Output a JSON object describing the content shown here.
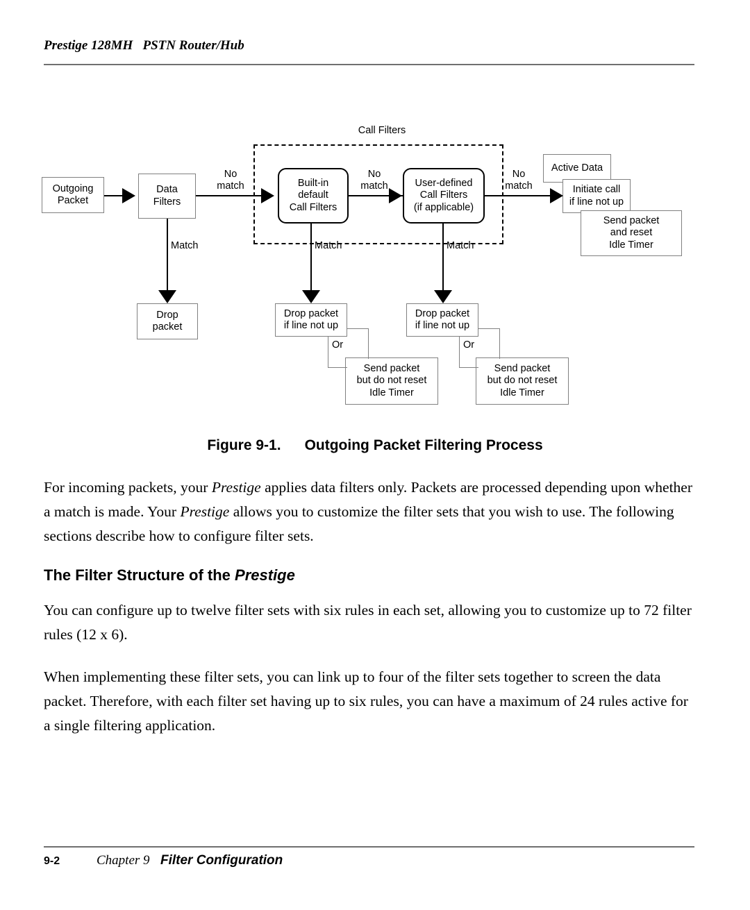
{
  "header": {
    "running_title": "Prestige 128MH   PSTN Router/Hub"
  },
  "figure": {
    "caption_number": "Figure 9-1.",
    "caption_title": "Outgoing Packet Filtering Process",
    "group_label": "Call Filters",
    "nodes": {
      "outgoing_packet": "Outgoing\nPacket",
      "data_filters": "Data\nFilters",
      "builtin_call_filters": "Built-in\ndefault\nCall Filters",
      "user_defined_call_filters": "User-defined\nCall Filters\n(if applicable)",
      "active_data": "Active Data",
      "initiate_call": "Initiate call\nif line not up",
      "send_and_reset": "Send packet\nand reset\nIdle Timer",
      "drop_packet": "Drop\npacket",
      "drop_packet_if_line_not_up_1": "Drop packet\nif line not up",
      "drop_packet_if_line_not_up_2": "Drop packet\nif line not up",
      "send_no_reset_1": "Send packet\nbut do not reset\nIdle Timer",
      "send_no_reset_2": "Send packet\nbut do not reset\nIdle Timer"
    },
    "edges": {
      "no_match_1": "No\nmatch",
      "no_match_2": "No\nmatch",
      "no_match_3": "No\nmatch",
      "match_1": "Match",
      "match_2": "Match",
      "match_3": "Match",
      "or_1": "Or",
      "or_2": "Or"
    }
  },
  "body": {
    "p1_a": "For incoming packets, your ",
    "p1_em1": "Prestige",
    "p1_b": " applies data filters only. Packets are processed depending upon whether a match is made. Your ",
    "p1_em2": "Prestige",
    "p1_c": " allows you to customize the filter sets that you wish to use. The following sections describe how to configure filter sets.",
    "section_heading_a": "The Filter Structure of the ",
    "section_heading_em": "Prestige",
    "p2": "You can configure up to twelve filter sets with six rules in each set, allowing you to customize up to 72 filter rules (12 x 6).",
    "p3": "When implementing these filter sets, you can link up to four of the filter sets together to screen the data packet. Therefore, with each filter set having up to six rules, you can have a maximum of 24 rules active for a single filtering application."
  },
  "footer": {
    "page_number": "9-2",
    "chapter": "Chapter 9",
    "chapter_title": "Filter Configuration"
  }
}
